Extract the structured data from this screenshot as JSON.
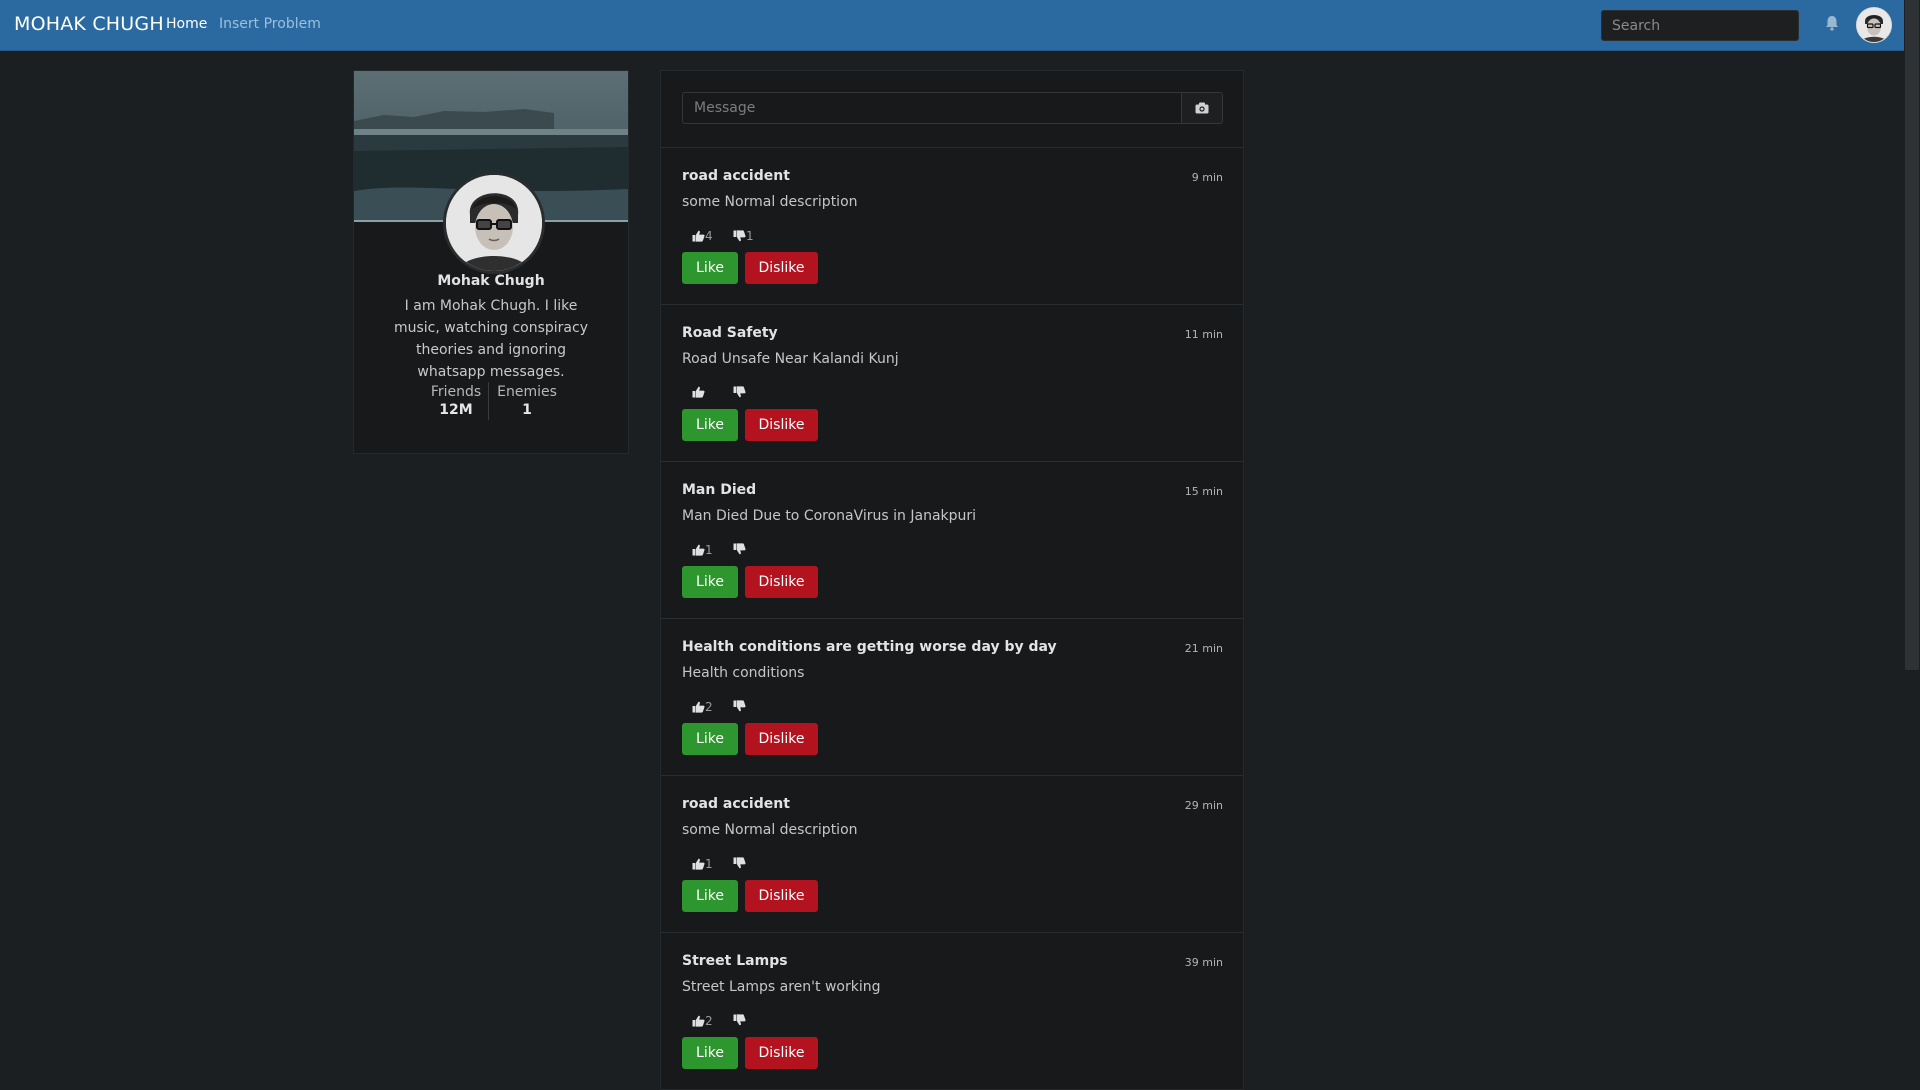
{
  "navbar": {
    "brand": "MOHAK CHUGH",
    "links": [
      "Home",
      "Insert Problem"
    ],
    "search_placeholder": "Search",
    "icons": [
      "bell-icon",
      "user-avatar"
    ]
  },
  "profile": {
    "name": "Mohak Chugh",
    "bio": "I am Mohak Chugh. I like music, watching conspiracy theories and ignoring whatsapp messages.",
    "stats": [
      {
        "label": "Friends",
        "value": "12M"
      },
      {
        "label": "Enemies",
        "value": "1"
      }
    ]
  },
  "composer": {
    "placeholder": "Message",
    "icon": "camera-icon"
  },
  "posts": [
    {
      "title": "road accident",
      "time": "9 min",
      "description": "some Normal description",
      "likes": "4",
      "dislikes": "1",
      "like_label": "Like",
      "dislike_label": "Dislike"
    },
    {
      "title": "Road Safety",
      "time": "11 min",
      "description": "Road Unsafe Near Kalandi Kunj",
      "likes": "",
      "dislikes": "",
      "like_label": "Like",
      "dislike_label": "Dislike"
    },
    {
      "title": "Man Died",
      "time": "15 min",
      "description": "Man Died Due to CoronaVirus in Janakpuri",
      "likes": "1",
      "dislikes": "",
      "like_label": "Like",
      "dislike_label": "Dislike"
    },
    {
      "title": "Health conditions are getting worse day by day",
      "time": "21 min",
      "description": "Health conditions",
      "likes": "2",
      "dislikes": "",
      "like_label": "Like",
      "dislike_label": "Dislike"
    },
    {
      "title": "road accident",
      "time": "29 min",
      "description": "some Normal description",
      "likes": "1",
      "dislikes": "",
      "like_label": "Like",
      "dislike_label": "Dislike"
    },
    {
      "title": "Street Lamps",
      "time": "39 min",
      "description": "Street Lamps aren't working",
      "likes": "2",
      "dislikes": "",
      "like_label": "Like",
      "dislike_label": "Dislike"
    }
  ],
  "colors": {
    "navbar": "#2a6aa0",
    "background": "#1c1f21",
    "like": "#2e962e",
    "dislike": "#b3131f"
  }
}
